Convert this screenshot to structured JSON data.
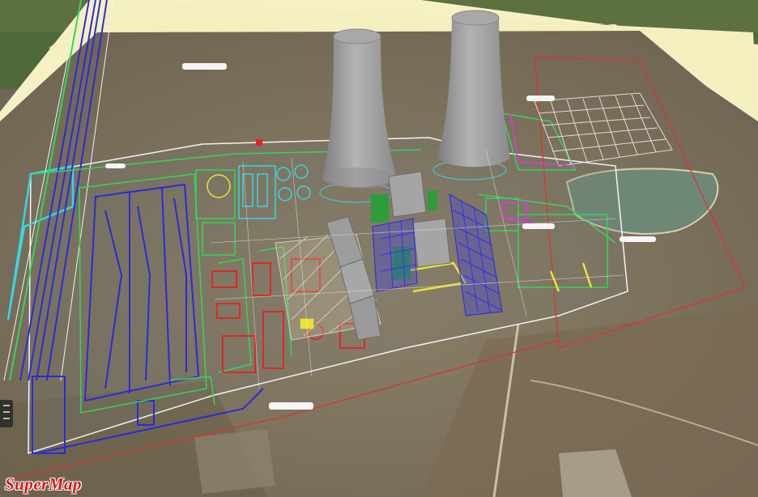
{
  "app": {
    "logo_text": "SuperMap"
  },
  "scene": {
    "description_labels": [],
    "layers": {
      "pipeline_colors": {
        "green": "#37d35a",
        "blue": "#2b2bd8",
        "red": "#e02424",
        "cyan": "#36d6e0",
        "yellow": "#e8e235",
        "magenta": "#d63cd6",
        "white": "#f2f2f2"
      }
    }
  }
}
